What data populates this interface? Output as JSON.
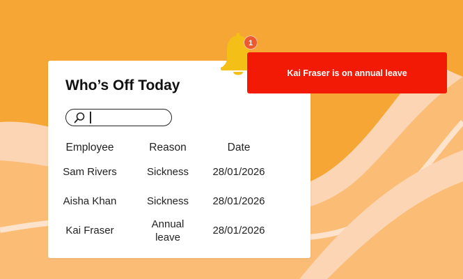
{
  "colors": {
    "background": "#f6a634",
    "toast": "#f21a05",
    "badge": "#ec5a2f",
    "bell": "#f4c017"
  },
  "card": {
    "title": "Who’s Off Today",
    "search": {
      "icon": "search-icon",
      "value": ""
    },
    "table": {
      "headers": [
        "Employee",
        "Reason",
        "Date"
      ],
      "rows": [
        {
          "employee": "Sam Rivers",
          "reason": "Sickness",
          "date": "28/01/2026"
        },
        {
          "employee": "Aisha Khan",
          "reason": "Sickness",
          "date": "28/01/2026"
        },
        {
          "employee": "Kai Fraser",
          "reason": "Annual leave",
          "date": "28/01/2026"
        }
      ]
    }
  },
  "notification": {
    "icon": "bell-icon",
    "count": "1",
    "message": "Kai Fraser is on annual leave"
  }
}
